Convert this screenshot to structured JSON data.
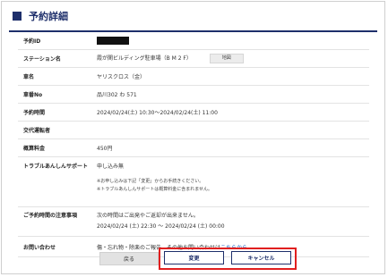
{
  "header": {
    "title": "予約詳細"
  },
  "details": {
    "reservation_id": {
      "label": "予約ID",
      "value": ""
    },
    "station": {
      "label": "ステーション名",
      "value": "霞が関ビルディング駐車場（B M 2 F）",
      "map_label": "地図"
    },
    "car_name": {
      "label": "車名",
      "value": "ヤリスクロス（金）"
    },
    "car_number": {
      "label": "車番No",
      "value": "品川302 わ 571"
    },
    "time": {
      "label": "予約時間",
      "value": "2024/02/24(土) 10:30～2024/02/24(土) 11:00"
    },
    "driver": {
      "label": "交代運転者",
      "value": ""
    },
    "fee": {
      "label": "概算料金",
      "value": "450円"
    },
    "trouble": {
      "label": "トラブルあんしんサポート",
      "value": "申し込み無",
      "note1": "※お申し込みは下記「変更」からお手続きください。",
      "note2": "※トラブルあんしんサポートは概算料金に含まれません。"
    },
    "caution": {
      "label": "ご予約時間の注意事項",
      "line1": "次の時間はご出発やご返却が出来ません。",
      "line2": "2024/02/24 (土) 22:30 ～ 2024/02/24 (土) 00:00"
    },
    "contact": {
      "label": "お問い合わせ",
      "text": "傷・忘れ物・除楽のご報告、その他お問い合わせは",
      "link": "こちらから"
    }
  },
  "buttons": {
    "back": "戻る",
    "edit": "変更",
    "cancel": "キャンセル"
  }
}
